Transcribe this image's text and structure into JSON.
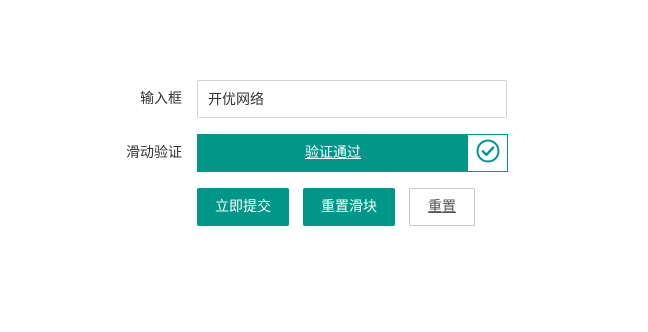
{
  "form": {
    "input_label": "输入框",
    "input_value": "开优网络",
    "slider_label": "滑动验证",
    "slider_status": "验证通过",
    "slider_handle_icon": "check-circle-icon",
    "submit_label": "立即提交",
    "reset_slider_label": "重置滑块",
    "reset_label": "重置"
  },
  "colors": {
    "accent": "#009688",
    "border": "#d2d2d2"
  }
}
